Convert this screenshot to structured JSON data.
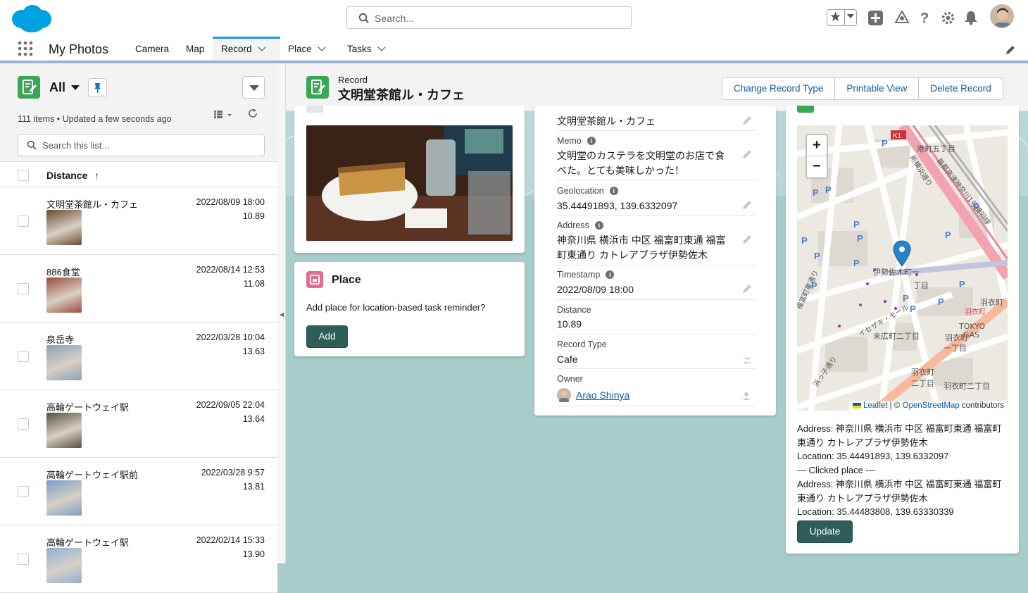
{
  "global": {
    "search_placeholder": "Search...",
    "brand_color": "#00a1e0"
  },
  "nav": {
    "app_name": "My Photos",
    "items": [
      {
        "label": "Camera",
        "has_menu": false
      },
      {
        "label": "Map",
        "has_menu": false
      },
      {
        "label": "Record",
        "has_menu": true,
        "active": true
      },
      {
        "label": "Place",
        "has_menu": true
      },
      {
        "label": "Tasks",
        "has_menu": true
      }
    ]
  },
  "list": {
    "view_name": "All",
    "meta": "111 items • Updated a few seconds ago",
    "search_placeholder": "Search this list...",
    "column": "Distance",
    "sort_icon": "↑",
    "rows": [
      {
        "name": "文明堂茶館ル・カフェ",
        "date": "2022/08/09 18:00",
        "distance": "10.89",
        "thumb": "#6b4a2f"
      },
      {
        "name": "886食堂",
        "date": "2022/08/14 12:53",
        "distance": "11.08",
        "thumb": "#9a4a3a"
      },
      {
        "name": "泉岳寺",
        "date": "2022/03/28 10:04",
        "distance": "13.63",
        "thumb": "#8aa2b8"
      },
      {
        "name": "高輪ゲートウェイ駅",
        "date": "2022/09/05 22:04",
        "distance": "13.64",
        "thumb": "#5a4d40"
      },
      {
        "name": "高輪ゲートウェイ駅前",
        "date": "2022/03/28 9:57",
        "distance": "13.81",
        "thumb": "#7b9cc7"
      },
      {
        "name": "高輪ゲートウェイ駅",
        "date": "2022/02/14 15:33",
        "distance": "13.90",
        "thumb": "#8fb0d8"
      }
    ]
  },
  "record": {
    "label": "Record",
    "title": "文明堂茶館ル・カフェ",
    "actions": [
      "Change Record Type",
      "Printable View",
      "Delete Record"
    ]
  },
  "place": {
    "title": "Place",
    "text": "Add place for location-based task reminder?",
    "add_label": "Add"
  },
  "details": {
    "name_value": "文明堂茶館ル・カフェ",
    "memo_label": "Memo",
    "memo_value_1": "文明堂のカステラを文明堂のお店で食",
    "memo_value_2": "べた。とても美味しかった！",
    "geo_label": "Geolocation",
    "geo_value": "35.44491893, 139.6332097",
    "address_label": "Address",
    "address_value_1": "神奈川県 横浜市 中区 福富町東通 福富",
    "address_value_2": "町東通り カトレアプラザ伊勢佐木",
    "timestamp_label": "Timestamp",
    "timestamp_value": "2022/08/09 18:00",
    "distance_label": "Distance",
    "distance_value": "10.89",
    "type_label": "Record Type",
    "type_value": "Cafe",
    "owner_label": "Owner",
    "owner_value": "Arao Shinya"
  },
  "map": {
    "zoom_in": "+",
    "zoom_out": "−",
    "attrib_leaflet": "Leaflet",
    "attrib_sep": " | © ",
    "attrib_osm": "OpenStreetMap",
    "attrib_contrib": " contributors",
    "labels": {
      "l1": "港町五丁目",
      "l2": "新横浜通り",
      "l3": "首都高速神奈川1号横羽線",
      "l4": "伊勢佐木町一",
      "l5": "丁目",
      "l6": "福富町東通り",
      "l7": "イセザキ・モール",
      "l8": "末広町二丁目",
      "l9": "羽衣町",
      "l10": "TOKYO",
      "l11": "GAS",
      "l12": "羽衣町",
      "l13": "一丁目",
      "l14": "羽衣町",
      "l15": "二丁目",
      "l16": "羽衣町二丁目",
      "l17": "浜っ子通り",
      "l18": "K1",
      "l19": "羽衣町"
    },
    "info": [
      "Address: 神奈川県 横浜市 中区 福富町東通 福富町",
      "東通り カトレアプラザ伊勢佐木",
      "Location: 35.44491893, 139.6332097",
      "--- Clicked place ---",
      "Address: 神奈川県 横浜市 中区 福富町東通 福富町",
      "東通り カトレアプラザ伊勢佐木",
      "Location: 35.44483808, 139.63330339"
    ],
    "update_label": "Update"
  }
}
